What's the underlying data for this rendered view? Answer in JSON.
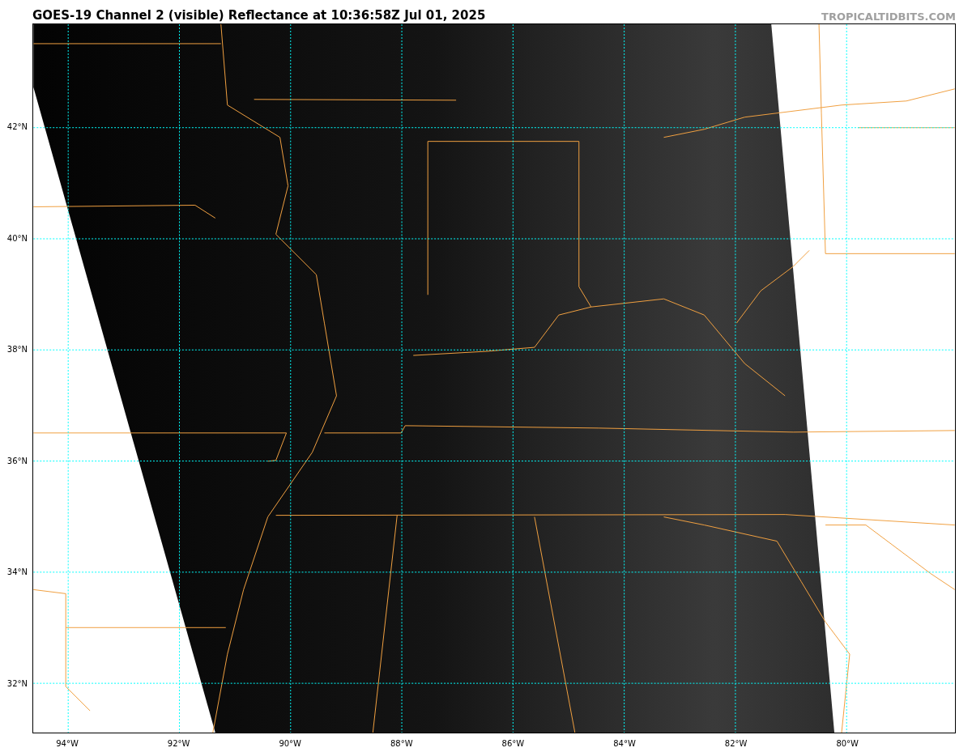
{
  "title": "GOES-19 Channel 2 (visible) Reflectance at 10:36:58Z Jul 01, 2025",
  "credit": "TROPICALTIDBITS.COM",
  "lat_labels": [
    "42°N",
    "40°N",
    "38°N",
    "36°N",
    "34°N",
    "32°N"
  ],
  "lon_labels": [
    "94°W",
    "92°W",
    "90°W",
    "88°W",
    "86°W",
    "84°W",
    "82°W",
    "80°W"
  ]
}
